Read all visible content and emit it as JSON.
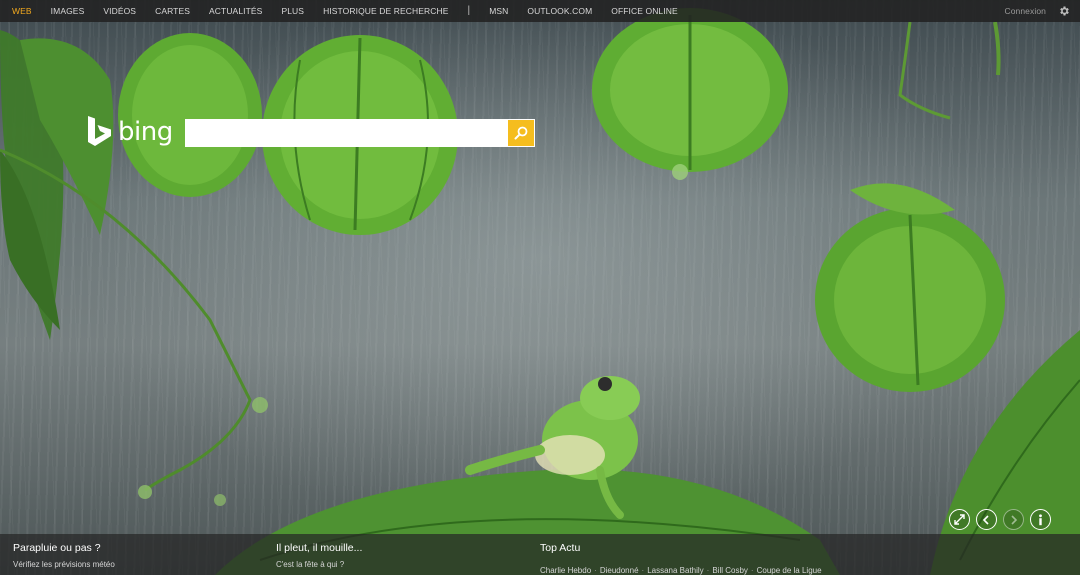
{
  "nav": {
    "items": [
      "WEB",
      "IMAGES",
      "VIDÉOS",
      "CARTES",
      "ACTUALITÉS",
      "PLUS",
      "HISTORIQUE DE RECHERCHE"
    ],
    "separator": "|",
    "extra": [
      "MSN",
      "OUTLOOK.COM",
      "OFFICE ONLINE"
    ],
    "signin": "Connexion",
    "settings_icon": "gear-icon"
  },
  "logo": {
    "text": "bing"
  },
  "search": {
    "value": "",
    "placeholder": "",
    "button_icon": "search-icon"
  },
  "controls": {
    "icons": [
      "expand-icon",
      "chevron-left-icon",
      "chevron-right-icon",
      "info-icon"
    ]
  },
  "bottom": {
    "col1": {
      "title": "Parapluie ou pas ?",
      "subtitle": "Vérifiez les prévisions météo"
    },
    "col2": {
      "title": "Il pleut, il mouille...",
      "subtitle": "C'est la fête à qui ?"
    },
    "col3": {
      "title": "Top Actu",
      "links": [
        "Charlie Hebdo",
        "Dieudonné",
        "Lassana Bathily",
        "Bill Cosby",
        "Coupe de la Ligue"
      ]
    }
  },
  "colors": {
    "accent": "#f2a91e",
    "search_button": "#f5bd1e",
    "topbar": "#222222"
  }
}
